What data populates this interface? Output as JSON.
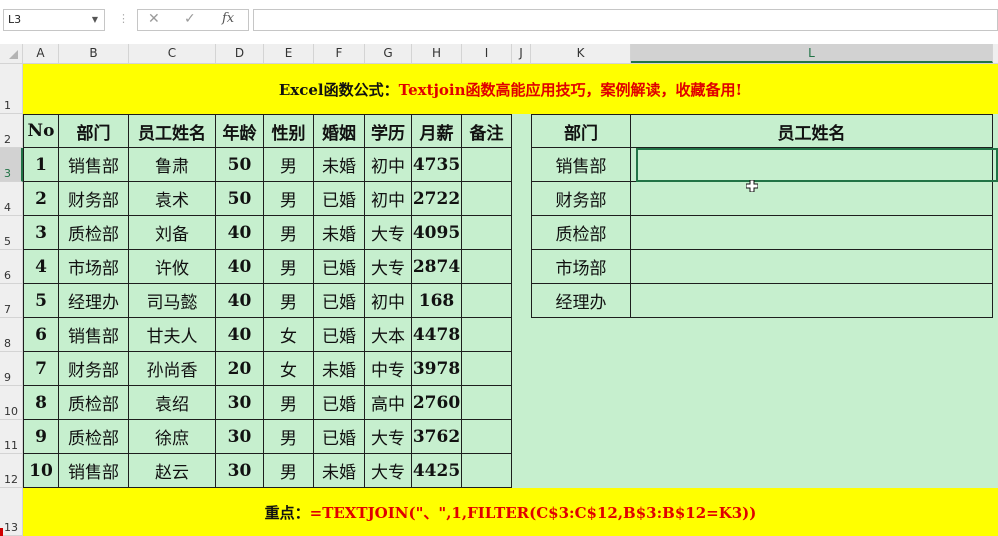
{
  "formula_bar": {
    "name_box": "L3",
    "fx_label": "fx",
    "formula": ""
  },
  "columns": [
    {
      "label": "A",
      "w": 36
    },
    {
      "label": "B",
      "w": 70
    },
    {
      "label": "C",
      "w": 87
    },
    {
      "label": "D",
      "w": 48
    },
    {
      "label": "E",
      "w": 50
    },
    {
      "label": "F",
      "w": 51
    },
    {
      "label": "G",
      "w": 47
    },
    {
      "label": "H",
      "w": 50
    },
    {
      "label": "I",
      "w": 50
    },
    {
      "label": "J",
      "w": 19
    },
    {
      "label": "K",
      "w": 100
    },
    {
      "label": "L",
      "w": 362
    }
  ],
  "selected_column": "L",
  "rows": [
    {
      "label": "1",
      "h": 50
    },
    {
      "label": "2",
      "h": 34
    },
    {
      "label": "3",
      "h": 34
    },
    {
      "label": "4",
      "h": 34
    },
    {
      "label": "5",
      "h": 34
    },
    {
      "label": "6",
      "h": 34
    },
    {
      "label": "7",
      "h": 34
    },
    {
      "label": "8",
      "h": 34
    },
    {
      "label": "9",
      "h": 34
    },
    {
      "label": "10",
      "h": 34
    },
    {
      "label": "11",
      "h": 34
    },
    {
      "label": "12",
      "h": 34
    },
    {
      "label": "13",
      "h": 48
    }
  ],
  "selected_row": "3",
  "title": {
    "prefix": "Excel函数公式：",
    "highlight": "Textjoin函数高能应用技巧，案例解读，收藏备用!"
  },
  "footer": {
    "prefix": "重点：",
    "highlight": "=TEXTJOIN(\"、\",1,FILTER(C$3:C$12,B$3:B$12=K3))"
  },
  "table": {
    "headers": [
      "No",
      "部门",
      "员工姓名",
      "年龄",
      "性别",
      "婚姻",
      "学历",
      "月薪",
      "备注"
    ],
    "rows": [
      [
        "1",
        "销售部",
        "鲁肃",
        "50",
        "男",
        "未婚",
        "初中",
        "4735",
        ""
      ],
      [
        "2",
        "财务部",
        "袁术",
        "50",
        "男",
        "已婚",
        "初中",
        "2722",
        ""
      ],
      [
        "3",
        "质检部",
        "刘备",
        "40",
        "男",
        "未婚",
        "大专",
        "4095",
        ""
      ],
      [
        "4",
        "市场部",
        "许攸",
        "40",
        "男",
        "已婚",
        "大专",
        "2874",
        ""
      ],
      [
        "5",
        "经理办",
        "司马懿",
        "40",
        "男",
        "已婚",
        "初中",
        "168",
        ""
      ],
      [
        "6",
        "销售部",
        "甘夫人",
        "40",
        "女",
        "已婚",
        "大本",
        "4478",
        ""
      ],
      [
        "7",
        "财务部",
        "孙尚香",
        "20",
        "女",
        "未婚",
        "中专",
        "3978",
        ""
      ],
      [
        "8",
        "质检部",
        "袁绍",
        "30",
        "男",
        "已婚",
        "高中",
        "2760",
        ""
      ],
      [
        "9",
        "质检部",
        "徐庶",
        "30",
        "男",
        "已婚",
        "大专",
        "3762",
        ""
      ],
      [
        "10",
        "销售部",
        "赵云",
        "30",
        "男",
        "未婚",
        "大专",
        "4425",
        ""
      ]
    ]
  },
  "lookup": {
    "headers": [
      "部门",
      "员工姓名"
    ],
    "rows": [
      [
        "销售部",
        ""
      ],
      [
        "财务部",
        ""
      ],
      [
        "质检部",
        ""
      ],
      [
        "市场部",
        ""
      ],
      [
        "经理办",
        ""
      ]
    ]
  },
  "colors": {
    "band": "#ffff00",
    "cell_fill": "#c6efce",
    "accent": "#217346",
    "red_text": "#e00000"
  }
}
